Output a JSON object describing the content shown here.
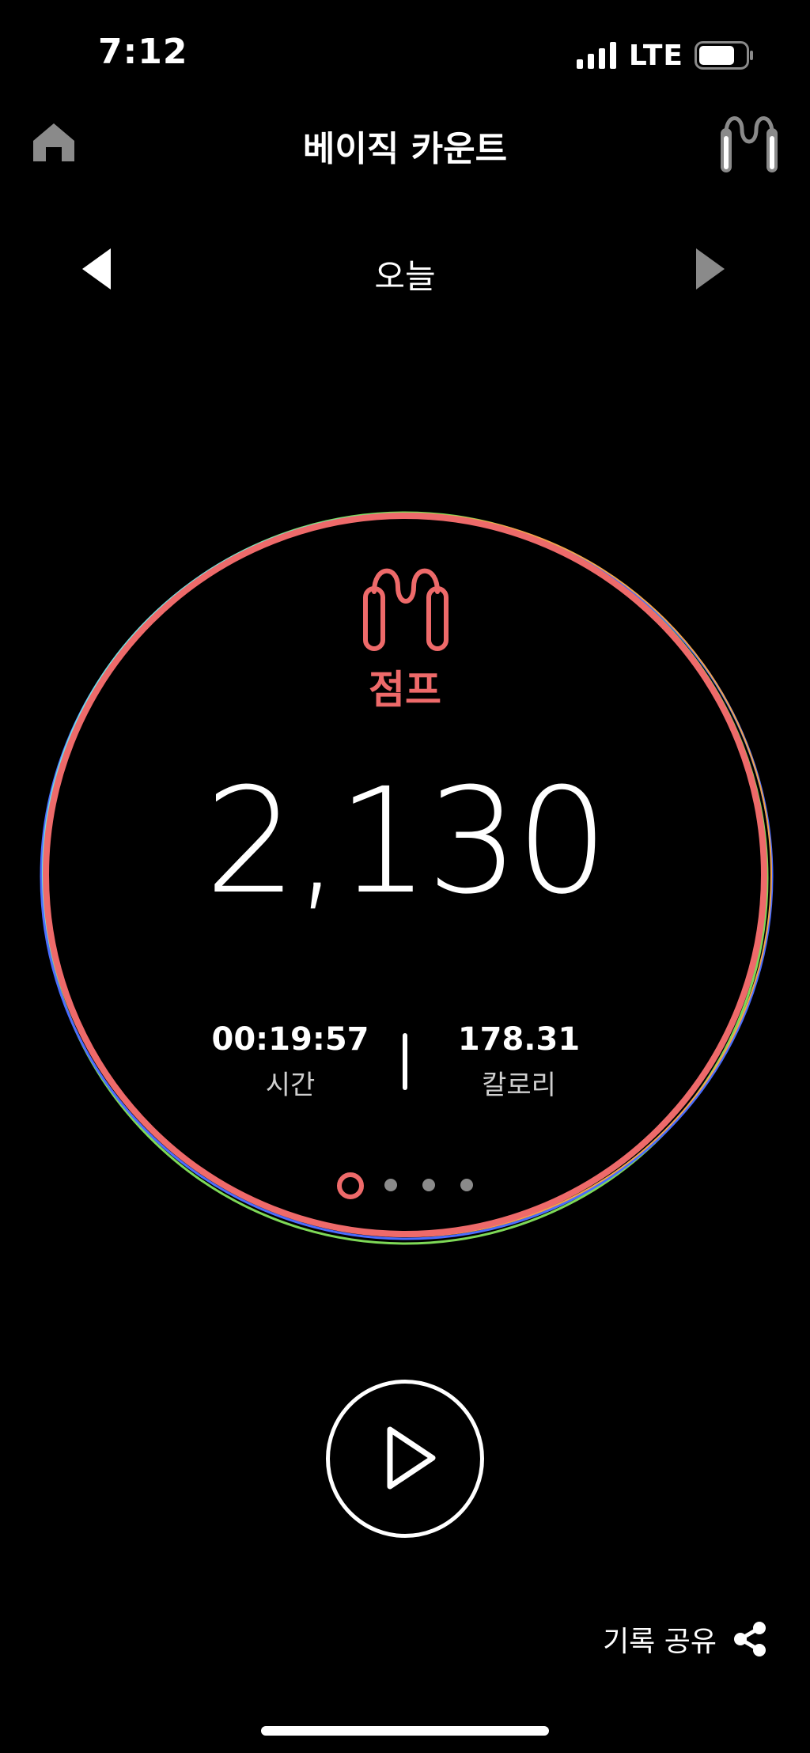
{
  "status_bar": {
    "time": "7:12",
    "network": "LTE",
    "battery_level": 0.75
  },
  "header": {
    "title": "베이직 카운트",
    "home_icon": "home-icon",
    "device_icon": "jump-rope-device-icon"
  },
  "date_nav": {
    "label": "오늘",
    "prev_icon": "triangle-left-icon",
    "next_icon": "triangle-right-icon"
  },
  "summary": {
    "activity_label": "점프",
    "activity_icon": "jump-rope-icon",
    "count": "2,130",
    "time_value": "00:19:57",
    "time_label": "시간",
    "calories_value": "178.31",
    "calories_label": "칼로리"
  },
  "pager": {
    "count": 4,
    "active_index": 0
  },
  "actions": {
    "play_icon": "play-icon",
    "share_label": "기록 공유",
    "share_icon": "share-icon"
  },
  "colors": {
    "accent": "#ee6a6a",
    "background": "#000000",
    "inactive": "#8a8a8a",
    "ring_green": "#7ed957",
    "ring_blue": "#4a6cff",
    "ring_cyan": "#6fe3e3",
    "ring_orange": "#f2a44a"
  }
}
